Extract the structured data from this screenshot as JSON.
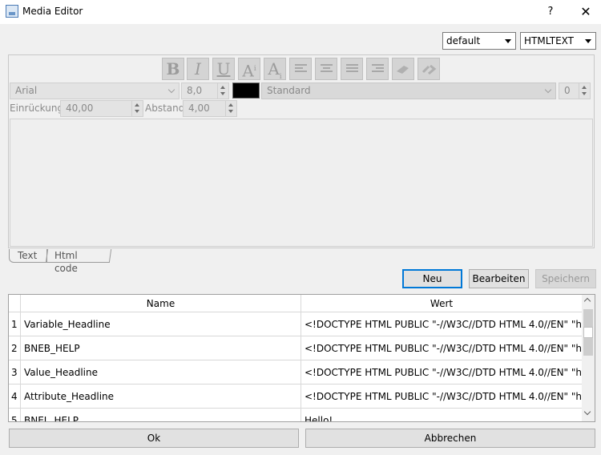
{
  "window": {
    "title": "Media Editor",
    "help_label": "?",
    "close_label": "✕"
  },
  "top_combos": {
    "style": "default",
    "format": "HTMLTEXT"
  },
  "toolbar": {
    "bold": "B",
    "italic": "I",
    "underline": "U",
    "superscript": "A",
    "superscript_mark": "i",
    "subscript": "A",
    "subscript_mark": "i"
  },
  "font_row": {
    "family": "Arial",
    "size": "8,0",
    "color": "#000000",
    "paragraph_style": "Standard",
    "paragraph_number": "0"
  },
  "indent_row": {
    "indent_label": "Einrückung:",
    "indent_value": "40,00",
    "spacing_label": "Abstand:",
    "spacing_value": "4,00"
  },
  "tabs": [
    {
      "label": "Text"
    },
    {
      "label": "Html code"
    }
  ],
  "actions": {
    "new": "Neu",
    "edit": "Bearbeiten",
    "save": "Speichern"
  },
  "table": {
    "columns": [
      "Name",
      "Wert"
    ],
    "rows": [
      {
        "num": "1",
        "name": "Variable_Headline",
        "value": "<!DOCTYPE HTML PUBLIC \"-//W3C//DTD HTML 4.0//EN\" \"htt..."
      },
      {
        "num": "2",
        "name": "BNEB_HELP",
        "value": "<!DOCTYPE HTML PUBLIC \"-//W3C//DTD HTML 4.0//EN\" \"htt..."
      },
      {
        "num": "3",
        "name": "Value_Headline",
        "value": "<!DOCTYPE HTML PUBLIC \"-//W3C//DTD HTML 4.0//EN\" \"htt..."
      },
      {
        "num": "4",
        "name": "Attribute_Headline",
        "value": "<!DOCTYPE HTML PUBLIC \"-//W3C//DTD HTML 4.0//EN\" \"htt..."
      },
      {
        "num": "5",
        "name": "BNEL_HELP",
        "value": "Hello!"
      }
    ]
  },
  "footer": {
    "ok": "Ok",
    "cancel": "Abbrechen"
  }
}
